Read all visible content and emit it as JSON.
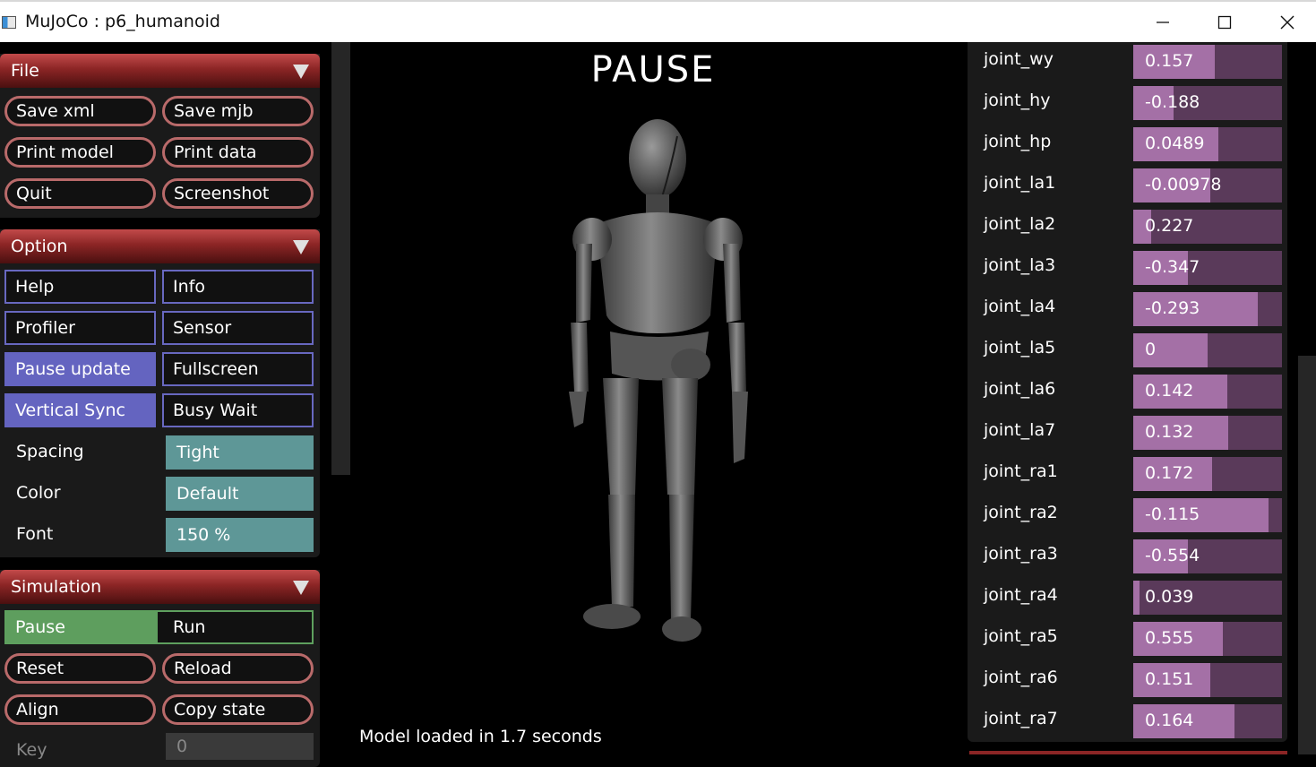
{
  "window": {
    "title": "MuJoCo : p6_humanoid"
  },
  "file": {
    "header": "File",
    "buttons": [
      "Save xml",
      "Save mjb",
      "Print model",
      "Print data",
      "Quit",
      "Screenshot"
    ]
  },
  "option": {
    "header": "Option",
    "toggles": [
      {
        "label": "Help",
        "on": false
      },
      {
        "label": "Info",
        "on": false
      },
      {
        "label": "Profiler",
        "on": false
      },
      {
        "label": "Sensor",
        "on": false
      },
      {
        "label": "Pause update",
        "on": true
      },
      {
        "label": "Fullscreen",
        "on": false
      },
      {
        "label": "Vertical Sync",
        "on": true
      },
      {
        "label": "Busy Wait",
        "on": false
      }
    ],
    "spacing_label": "Spacing",
    "spacing_value": "Tight",
    "color_label": "Color",
    "color_value": "Default",
    "font_label": "Font",
    "font_value": "150 %"
  },
  "simulation": {
    "header": "Simulation",
    "mode_options": [
      "Pause",
      "Run"
    ],
    "mode_selected": "Pause",
    "buttons": [
      "Reset",
      "Reload",
      "Align",
      "Copy state"
    ],
    "key_label": "Key",
    "key_value": "0"
  },
  "viewport": {
    "overlay": "PAUSE",
    "status": "Model loaded in 1.7 seconds"
  },
  "joints": [
    {
      "name": "joint_wy",
      "value": "0.157",
      "fill": 0.55
    },
    {
      "name": "joint_hy",
      "value": "-0.188",
      "fill": 0.27
    },
    {
      "name": "joint_hp",
      "value": "0.0489",
      "fill": 0.57
    },
    {
      "name": "joint_la1",
      "value": "-0.00978",
      "fill": 0.52
    },
    {
      "name": "joint_la2",
      "value": "0.227",
      "fill": 0.12
    },
    {
      "name": "joint_la3",
      "value": "-0.347",
      "fill": 0.37
    },
    {
      "name": "joint_la4",
      "value": "-0.293",
      "fill": 0.84
    },
    {
      "name": "joint_la5",
      "value": "0",
      "fill": 0.5
    },
    {
      "name": "joint_la6",
      "value": "0.142",
      "fill": 0.63
    },
    {
      "name": "joint_la7",
      "value": "0.132",
      "fill": 0.64
    },
    {
      "name": "joint_ra1",
      "value": "0.172",
      "fill": 0.53
    },
    {
      "name": "joint_ra2",
      "value": "-0.115",
      "fill": 0.91
    },
    {
      "name": "joint_ra3",
      "value": "-0.554",
      "fill": 0.37
    },
    {
      "name": "joint_ra4",
      "value": "0.039",
      "fill": 0.04
    },
    {
      "name": "joint_ra5",
      "value": "0.555",
      "fill": 0.6
    },
    {
      "name": "joint_ra6",
      "value": "0.151",
      "fill": 0.52
    },
    {
      "name": "joint_ra7",
      "value": "0.164",
      "fill": 0.68
    }
  ],
  "icons": {
    "minimize": "minimize-icon",
    "maximize": "maximize-icon",
    "close": "close-icon",
    "collapse": "triangle-down-icon"
  },
  "colors": {
    "section_header": "#8b2525",
    "toggle_on": "#6464c0",
    "select_bg": "#5e9797",
    "radio_on": "#5e9e5e",
    "slider_fill": "#a470a6",
    "slider_track": "#5a3a5a"
  }
}
